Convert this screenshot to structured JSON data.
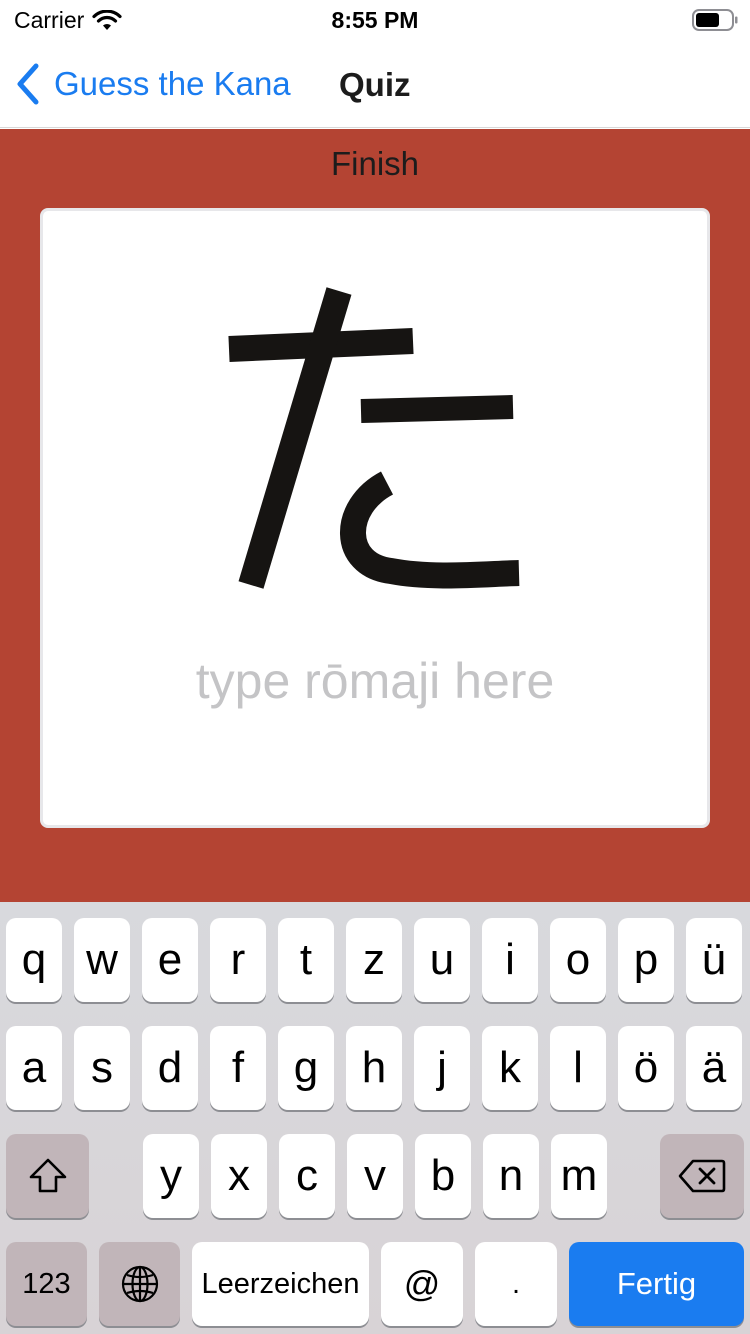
{
  "status_bar": {
    "carrier": "Carrier",
    "time": "8:55 PM"
  },
  "nav": {
    "back_label": "Guess the Kana",
    "title": "Quiz"
  },
  "quiz": {
    "finish_label": "Finish",
    "kana": "た",
    "input_placeholder": "type rōmaji here",
    "input_value": ""
  },
  "keyboard": {
    "row1": [
      "q",
      "w",
      "e",
      "r",
      "t",
      "z",
      "u",
      "i",
      "o",
      "p",
      "ü"
    ],
    "row2": [
      "a",
      "s",
      "d",
      "f",
      "g",
      "h",
      "j",
      "k",
      "l",
      "ö",
      "ä"
    ],
    "row3": [
      "y",
      "x",
      "c",
      "v",
      "b",
      "n",
      "m"
    ],
    "numbers_label": "123",
    "space_label": "Leerzeichen",
    "at_label": "@",
    "dot_label": ".",
    "done_label": "Fertig",
    "shift_icon": "shift-icon",
    "delete_icon": "delete-icon",
    "globe_icon": "globe-icon"
  },
  "colors": {
    "accent": "#1a7cf0",
    "background": "#b44433",
    "card": "#ffffff"
  }
}
